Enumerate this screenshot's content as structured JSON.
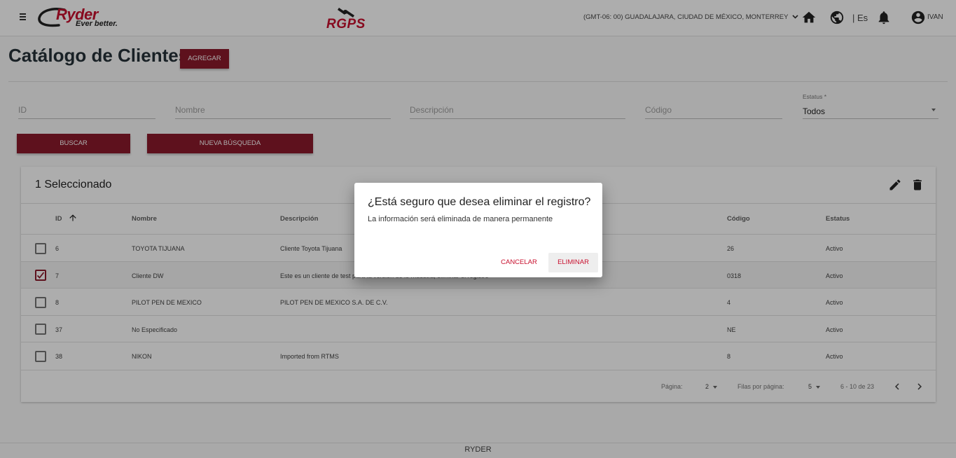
{
  "header": {
    "brand": "Ryder",
    "tagline": "Ever better.",
    "app_logo": "RGPS",
    "timezone": "(GMT-06: 00) GUADALAJARA, CIUDAD DE MÉXICO, MONTERREY",
    "language": "| Es",
    "user": "IVAN",
    "icons": [
      "menu-icon",
      "home-icon",
      "globe-icon",
      "bell-icon",
      "account-circle-icon"
    ]
  },
  "page": {
    "title": "Catálogo de Clientes",
    "add_button": "AGREGAR"
  },
  "filters": {
    "id_placeholder": "ID",
    "nombre_placeholder": "Nombre",
    "descripcion_placeholder": "Descripción",
    "codigo_placeholder": "Código",
    "estatus_label": "Estatus *",
    "estatus_value": "Todos",
    "search_button": "BUSCAR",
    "new_search_button": "NUEVA BÚSQUEDA"
  },
  "table": {
    "selection_title": "1 Seleccionado",
    "columns": {
      "id": "ID",
      "nombre": "Nombre",
      "descripcion": "Descripción",
      "codigo": "Código",
      "estatus": "Estatus"
    },
    "rows": [
      {
        "id": "6",
        "nombre": "TOYOTA TIJUANA",
        "descripcion": "Cliente Toyota Tijuana",
        "codigo": "26",
        "estatus": "Activo",
        "checked": false
      },
      {
        "id": "7",
        "nombre": "Cliente DW",
        "descripcion": "Este es un cliente de test para la version de lo muestra, eliminar el registro",
        "codigo": "0318",
        "estatus": "Activo",
        "checked": true
      },
      {
        "id": "8",
        "nombre": "PILOT PEN DE MEXICO",
        "descripcion": "PILOT PEN DE MEXICO S.A. DE C.V.",
        "codigo": "4",
        "estatus": "Activo",
        "checked": false
      },
      {
        "id": "37",
        "nombre": "No Especificado",
        "descripcion": "",
        "codigo": "NE",
        "estatus": "Activo",
        "checked": false
      },
      {
        "id": "38",
        "nombre": "NIKON",
        "descripcion": "Imported from RTMS",
        "codigo": "8",
        "estatus": "Activo",
        "checked": false
      }
    ],
    "pagination": {
      "page_label": "Página:",
      "page_value": "2",
      "rows_label": "Filas por página:",
      "rows_value": "5",
      "range": "6 - 10 de 23"
    }
  },
  "footer": {
    "text": "RYDER"
  },
  "dialog": {
    "title": "¿Está seguro que desea eliminar el registro?",
    "message": "La información será eliminada de manera permanente",
    "cancel": "CANCELAR",
    "confirm": "ELIMINAR"
  },
  "colors": {
    "brand_red": "#c8102e",
    "button_red": "#8b1a2b",
    "overlay": "rgba(0,0,0,0.32)"
  }
}
